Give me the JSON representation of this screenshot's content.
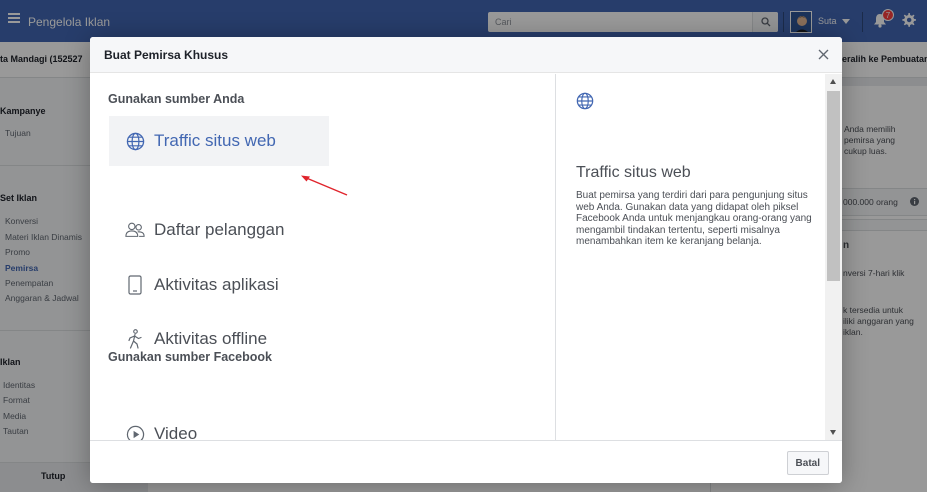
{
  "topbar": {
    "app_title": "Pengelola Iklan",
    "search_placeholder": "Cari",
    "user_name": "Suta",
    "notification_count": "7"
  },
  "background": {
    "campaign_name": "ta Mandagi (152527",
    "switch_label": "eralih ke Pembuatan",
    "left_nav": {
      "campaign_heading": "Kampanye",
      "campaign_items": [
        "Tujuan"
      ],
      "adset_heading": "Set Iklan",
      "adset_items": [
        "Konversi",
        "Materi Iklan Dinamis",
        "Promo",
        "Pemirsa",
        "Penempatan",
        "Anggaran & Jadwal"
      ],
      "ad_heading": "Iklan",
      "ad_items": [
        "Identitas",
        "Format",
        "Media",
        "Tautan"
      ],
      "close_label": "Tutup"
    },
    "right_panel": {
      "audience_text": "Anda memilih\npemirsa yang\ncukup luas.",
      "reach_text": "000.000 orang",
      "heading": "n",
      "conversion_text": "nversi 7-hari klik",
      "availability_text": "k tersedia untuk\niliki anggaran yang\niklan."
    }
  },
  "modal": {
    "title": "Buat Pemirsa Khusus",
    "section_own": "Gunakan sumber Anda",
    "section_facebook": "Gunakan sumber Facebook",
    "sources": [
      {
        "label": "Traffic situs web",
        "icon": "globe-icon"
      },
      {
        "label": "Daftar pelanggan",
        "icon": "people-icon"
      },
      {
        "label": "Aktivitas aplikasi",
        "icon": "mobile-icon"
      },
      {
        "label": "Aktivitas offline",
        "icon": "walking-person-icon"
      }
    ],
    "facebook_sources": [
      {
        "label": "Video",
        "icon": "play-icon"
      }
    ],
    "detail": {
      "title": "Traffic situs web",
      "description": "Buat pemirsa yang terdiri dari para pengunjung situs web Anda. Gunakan data yang didapat oleh piksel Facebook Anda untuk menjangkau orang-orang yang mengambil tindakan tertentu, seperti misalnya menambahkan item ke keranjang belanja."
    },
    "cancel_label": "Batal"
  },
  "colors": {
    "brand_blue": "#4267b2",
    "annotation_red": "#e0242c",
    "notification_red": "#fa3e3e"
  }
}
